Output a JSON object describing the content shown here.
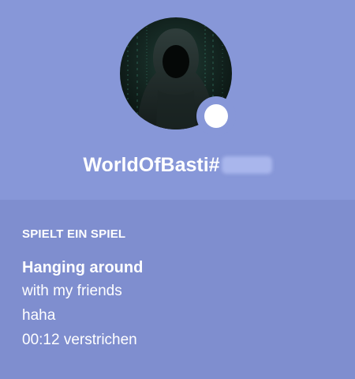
{
  "profile": {
    "username": "WorldOfBasti#",
    "status": "online",
    "colors": {
      "header_bg": "#8797D8",
      "body_bg": "#7F8ECF",
      "text": "#FFFFFF",
      "status_dot": "#FFFFFF"
    }
  },
  "activity": {
    "header": "SPIELT EIN SPIEL",
    "name": "Hanging around",
    "details": "with my friends",
    "state": "haha",
    "elapsed": "00:12 verstrichen"
  }
}
